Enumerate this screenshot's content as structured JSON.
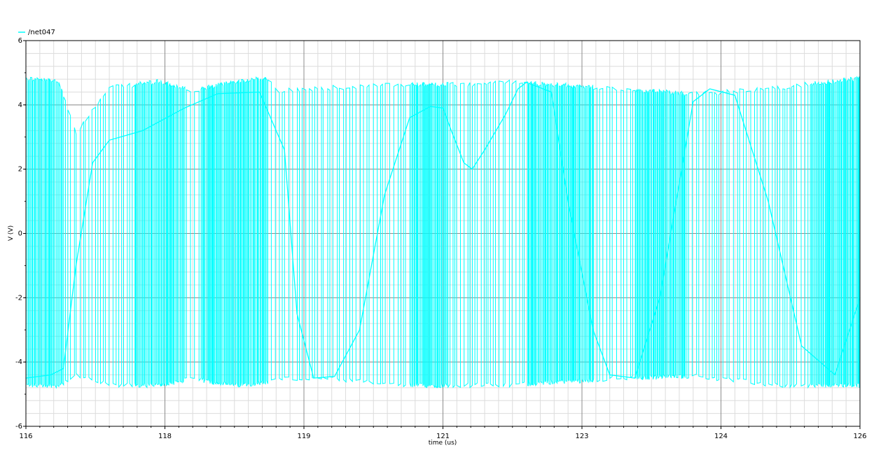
{
  "chart_data": {
    "type": "line",
    "xlabel": "time (us)",
    "ylabel": "V (V)",
    "xlim": [
      116,
      126
    ],
    "ylim": [
      -6,
      6
    ],
    "x_ticks": [
      "116",
      "118",
      "119",
      "121",
      "123",
      "124",
      "126"
    ],
    "y_ticks": [
      "6",
      "4",
      "2",
      "0",
      "-2",
      "-4",
      "-6"
    ],
    "grid": true,
    "legend": "top-left",
    "series": [
      {
        "name": "/net047",
        "color": "#00ffff",
        "envelope_description_points": {
          "x": [
            116.0,
            116.4,
            116.6,
            117.0,
            117.6,
            118.0,
            118.5,
            118.9,
            119.0,
            119.6,
            120.5,
            121.1,
            121.3,
            121.8,
            122.3,
            123.0,
            124.0,
            125.0,
            126.0
          ],
          "upper": [
            4.9,
            4.8,
            3.2,
            4.6,
            4.8,
            4.5,
            4.8,
            4.9,
            4.5,
            4.6,
            4.7,
            4.7,
            4.7,
            4.8,
            4.7,
            4.6,
            4.4,
            4.6,
            4.9
          ],
          "lower": [
            -4.8,
            -4.8,
            -4.5,
            -4.8,
            -4.8,
            -4.6,
            -4.8,
            -4.7,
            -4.6,
            -4.6,
            -4.8,
            -4.8,
            -4.8,
            -4.8,
            -4.7,
            -4.6,
            -4.5,
            -4.8,
            -4.8
          ]
        },
        "slow_waveform": {
          "x": [
            116.0,
            116.3,
            116.45,
            116.6,
            116.8,
            117.0,
            117.4,
            117.9,
            118.3,
            118.8,
            119.1,
            119.25,
            119.45,
            119.7,
            120.0,
            120.3,
            120.6,
            120.85,
            121.0,
            121.1,
            121.25,
            121.35,
            121.5,
            121.75,
            121.9,
            122.0,
            122.3,
            122.5,
            122.8,
            123.0,
            123.3,
            123.6,
            123.85,
            124.0,
            124.2,
            124.5,
            124.9,
            125.3,
            125.7,
            126.0
          ],
          "y": [
            -4.5,
            -4.4,
            -4.2,
            -1.0,
            2.2,
            2.9,
            3.2,
            3.9,
            4.35,
            4.4,
            2.6,
            -2.5,
            -4.5,
            -4.45,
            -3.0,
            1.2,
            3.6,
            3.95,
            3.9,
            3.2,
            2.2,
            2.0,
            2.6,
            3.7,
            4.5,
            4.7,
            4.4,
            1.0,
            -3.0,
            -4.4,
            -4.5,
            -2.0,
            1.8,
            4.1,
            4.5,
            4.3,
            1.0,
            -3.5,
            -4.4,
            -2.0
          ]
        }
      }
    ]
  }
}
